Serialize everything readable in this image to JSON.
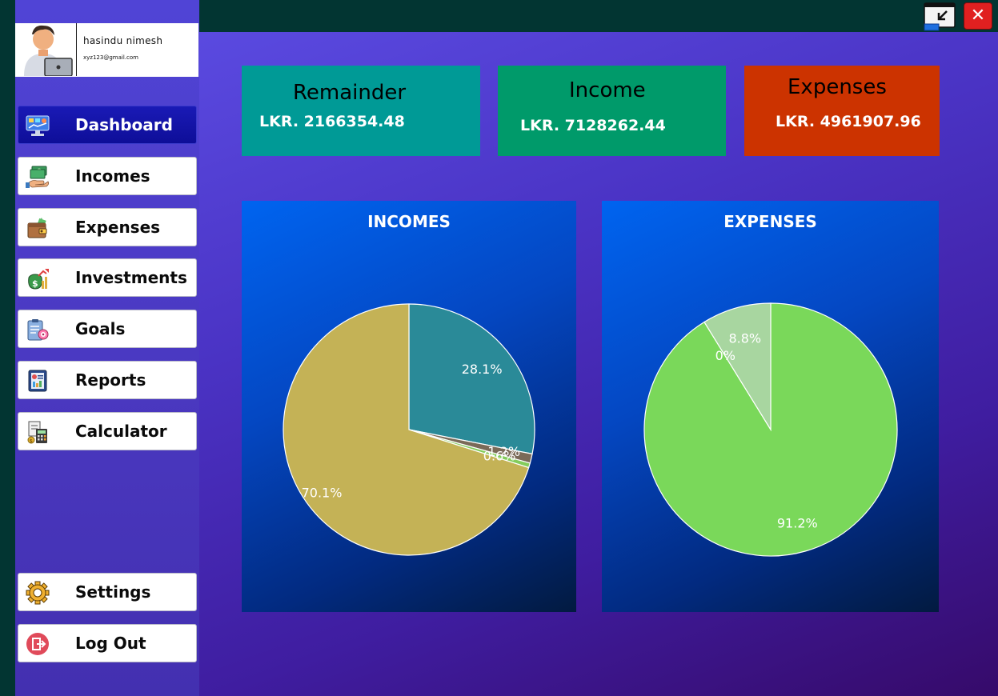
{
  "user": {
    "name": "hasindu nimesh",
    "email": "xyz123@gmail.com"
  },
  "nav": {
    "items": [
      {
        "label": "Dashboard",
        "icon": "dashboard-monitor-icon",
        "active": true
      },
      {
        "label": "Incomes",
        "icon": "money-hand-icon",
        "active": false
      },
      {
        "label": "Expenses",
        "icon": "wallet-icon",
        "active": false
      },
      {
        "label": "Investments",
        "icon": "investment-growth-icon",
        "active": false
      },
      {
        "label": "Goals",
        "icon": "goals-clipboard-icon",
        "active": false
      },
      {
        "label": "Reports",
        "icon": "report-document-icon",
        "active": false
      },
      {
        "label": "Calculator",
        "icon": "calculator-icon",
        "active": false
      }
    ],
    "bottom": [
      {
        "label": "Settings",
        "icon": "gear-icon"
      },
      {
        "label": "Log Out",
        "icon": "logout-icon"
      }
    ]
  },
  "window": {
    "restore_icon": "restore-window-icon",
    "close_icon": "close-icon",
    "close_glyph": "✕"
  },
  "summary": {
    "remainder": {
      "title": "Remainder",
      "value": "LKR. 2166354.48",
      "color": "#009a96"
    },
    "income": {
      "title": "Income",
      "value": "LKR. 7128262.44",
      "color": "#009a6a"
    },
    "expenses": {
      "title": "Expenses",
      "value": "LKR. 4961907.96",
      "color": "#cc3300"
    }
  },
  "chart_data": [
    {
      "type": "pie",
      "title": "INCOMES",
      "series": [
        {
          "value": 28.1,
          "label": "28.1%",
          "color": "#2a8a98"
        },
        {
          "value": 1.2,
          "label": "1.2%",
          "color": "#7a6a58"
        },
        {
          "value": 0.6,
          "label": "0.6%",
          "color": "#84cc5c"
        },
        {
          "value": 70.1,
          "label": "70.1%",
          "color": "#c4b256"
        }
      ]
    },
    {
      "type": "pie",
      "title": "EXPENSES",
      "series": [
        {
          "value": 91.2,
          "label": "91.2%",
          "color": "#7ad85a"
        },
        {
          "value": 0,
          "label": "0%",
          "color": "#6aa8a0"
        },
        {
          "value": 8.8,
          "label": "8.8%",
          "color": "#a8d6a0"
        }
      ]
    }
  ]
}
